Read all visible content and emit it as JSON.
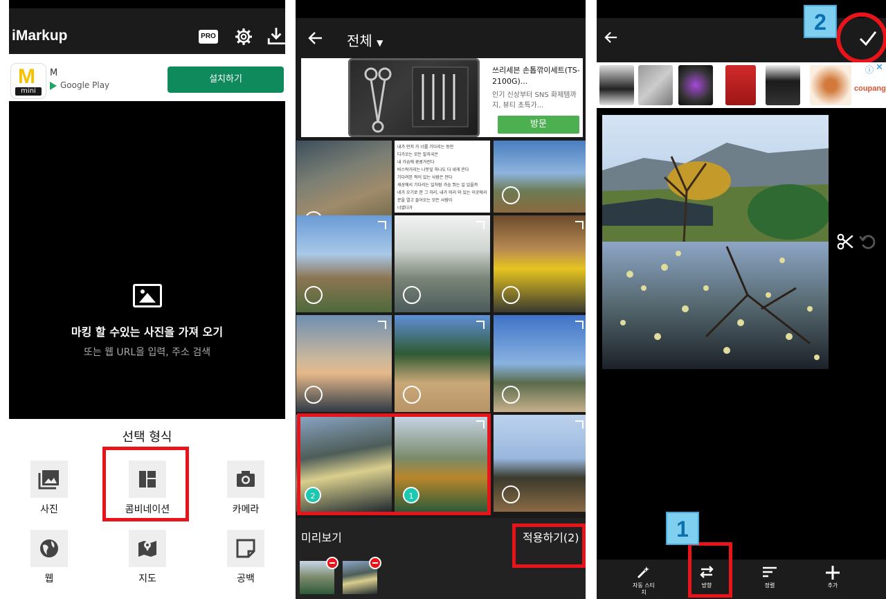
{
  "panel1": {
    "app_title": "iMarkup",
    "pro_badge": "PRO",
    "ad": {
      "app_name": "M",
      "logo_letter": "M",
      "logo_sub": "mini",
      "store": "Google Play",
      "install_label": "설치하기"
    },
    "empty_title": "마킹 할 수있는 사진을 가져 오기",
    "empty_subtitle": "또는 웹 URL을 입력, 주소 검색",
    "select_heading": "선택 형식",
    "options": [
      {
        "label": "사진",
        "icon": "photo-library-icon"
      },
      {
        "label": "콤비네이션",
        "icon": "combination-icon"
      },
      {
        "label": "카메라",
        "icon": "camera-icon"
      },
      {
        "label": "웹",
        "icon": "globe-icon"
      },
      {
        "label": "지도",
        "icon": "map-icon"
      },
      {
        "label": "공백",
        "icon": "blank-note-icon"
      }
    ]
  },
  "panel2": {
    "title": "전체",
    "ad": {
      "name": "쓰리세븐 손톱깎이세트(TS-2100G)...",
      "desc": "인기 신상부터 SNS 화제템까지, 뷰티 초특가...",
      "visit_label": "방문"
    },
    "text_card_lines": [
      "내가 먼저 가 너를 기다리는 동안",
      "다가오는 모든 발자국은",
      "내 가슴에 쿵쿵거린다",
      "바스락거리는 나뭇잎 하나도 다 네게 온다",
      "기다려본 적이 있는 사람은 안다",
      "세상에서 기다리는 일처럼 가슴 뛰는 일 있을까",
      "네가 오기로 한 그 자리, 내가 미리 와 있는 이곳에서",
      "문을 열고 들어오는 모든 사람이",
      "너였다가"
    ],
    "selected_numbers": [
      "2",
      "1"
    ],
    "preview_label": "미리보기",
    "apply_label": "적용하기(2)"
  },
  "panel3": {
    "ad_brand": "coupang",
    "tools": [
      {
        "label": "자동 스티치",
        "icon": "magic-wand-icon"
      },
      {
        "label": "방향",
        "icon": "swap-direction-icon"
      },
      {
        "label": "정렬",
        "icon": "sort-icon"
      },
      {
        "label": "추가",
        "icon": "plus-icon"
      }
    ]
  },
  "annotations": {
    "step1": "1",
    "step2": "2"
  },
  "colors": {
    "accent_red": "#e8141a",
    "teal_badge": "#1dc7b0",
    "install_green": "#0f8a5c",
    "visit_green": "#4caf50",
    "step_badge": "#7fd0f0"
  }
}
